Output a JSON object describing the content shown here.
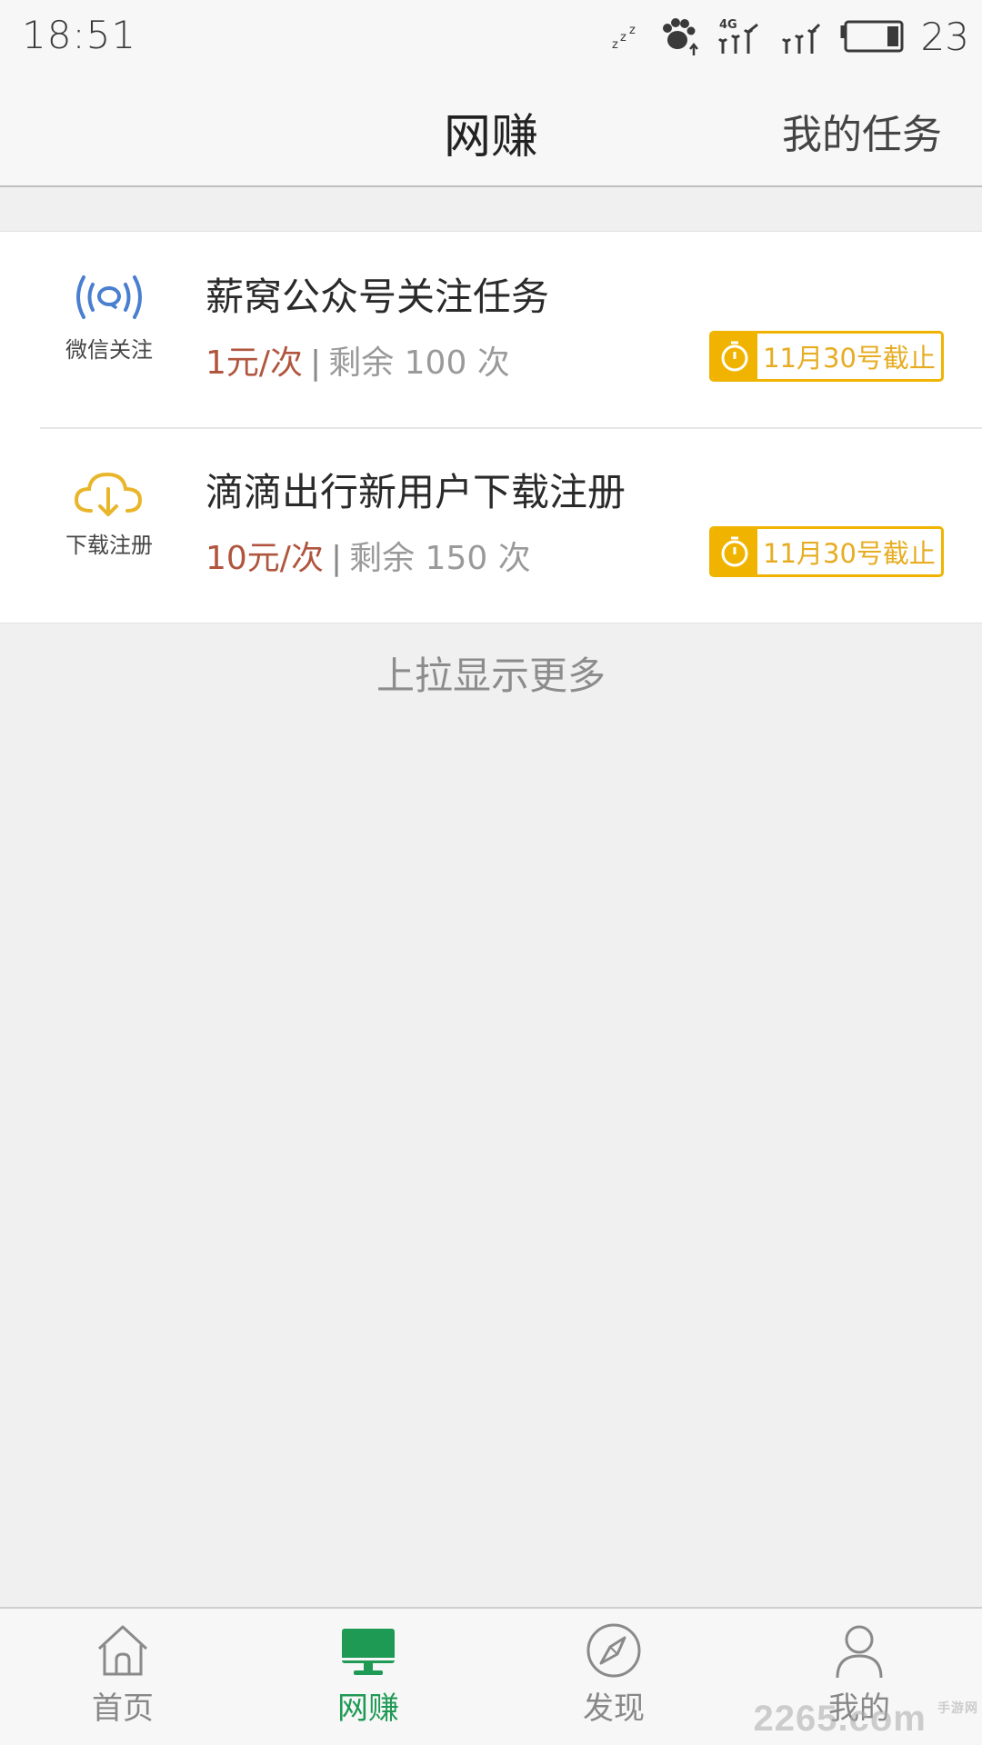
{
  "status_bar": {
    "time": "18:51",
    "network": "4G",
    "battery_level": "23",
    "icons": [
      "sleep-icon",
      "paw-icon",
      "signal-icon",
      "signal-icon",
      "battery-icon"
    ]
  },
  "header": {
    "title": "网赚",
    "right_action": "我的任务"
  },
  "tasks": [
    {
      "category": "微信关注",
      "icon": "wechat-follow-icon",
      "title": "薪窝公众号关注任务",
      "price": "1元/次",
      "separator": "|",
      "remaining": "剩余 100 次",
      "deadline": "11月30号截止"
    },
    {
      "category": "下载注册",
      "icon": "cloud-download-icon",
      "title": "滴滴出行新用户下载注册",
      "price": "10元/次",
      "separator": "|",
      "remaining": "剩余 150 次",
      "deadline": "11月30号截止"
    }
  ],
  "list_footer": "上拉显示更多",
  "tabs": [
    {
      "label": "首页",
      "icon": "home-icon",
      "active": false
    },
    {
      "label": "网赚",
      "icon": "monitor-icon",
      "active": true
    },
    {
      "label": "发现",
      "icon": "compass-icon",
      "active": false
    },
    {
      "label": "我的",
      "icon": "user-icon",
      "active": false
    }
  ],
  "watermark": {
    "text": "2265",
    "suffix": ".com",
    "sub": "手游网"
  },
  "colors": {
    "price": "#b0553e",
    "deadline": "#f0b400",
    "active_tab": "#1f9a55",
    "wechat_icon": "#4a7fd0",
    "download_icon": "#e9b52a"
  }
}
